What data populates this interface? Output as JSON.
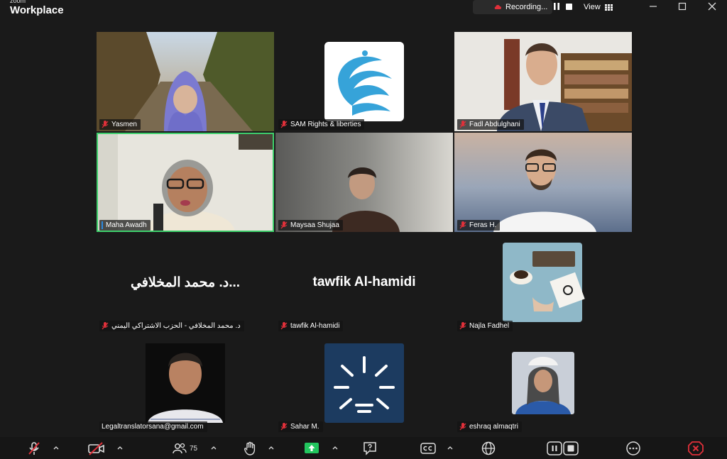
{
  "app": {
    "brand_small": "zoom",
    "brand_big": "Workplace"
  },
  "topbar": {
    "recording_label": "Recording...",
    "view_label": "View"
  },
  "participants": [
    {
      "name": "Yasmen"
    },
    {
      "name": "SAM Rights & liberties"
    },
    {
      "name": "Fadl Abdulghani"
    },
    {
      "name": "Maha Awadh"
    },
    {
      "name": "Maysaa Shujaa"
    },
    {
      "name": "Feras H."
    },
    {
      "name": "د. محمد المخلافي - الحزب الاشتراكي اليمني",
      "display": "د. محمد المخلافي..."
    },
    {
      "name": "tawfik Al-hamidi",
      "display": "tawfik Al-hamidi"
    },
    {
      "name": "Najla Fadhel"
    },
    {
      "name": "Legaltranslatorsana@gmail.com"
    },
    {
      "name": "Sahar M."
    },
    {
      "name": "eshraq almaqtri"
    }
  ],
  "toolbar": {
    "participants_count": "75"
  },
  "colors": {
    "active_speaker": "#3ecf6b",
    "end": "#e0303a",
    "share": "#22c55e",
    "mic_off": "#e0303a"
  }
}
